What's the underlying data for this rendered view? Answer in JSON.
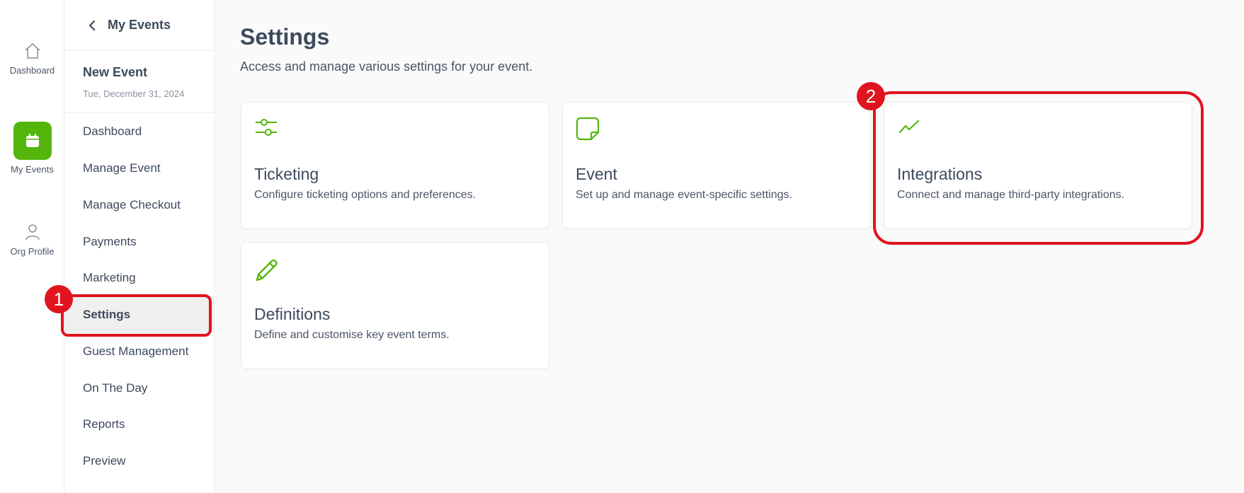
{
  "rail": {
    "items": [
      {
        "label": "Dashboard",
        "icon": "home-icon"
      },
      {
        "label": "My Events",
        "icon": "calendar-icon",
        "active": true
      },
      {
        "label": "Org Profile",
        "icon": "user-icon"
      }
    ]
  },
  "sidenav": {
    "back_label": "My Events",
    "event_name": "New Event",
    "event_date": "Tue, December 31, 2024",
    "items": [
      {
        "label": "Dashboard"
      },
      {
        "label": "Manage Event"
      },
      {
        "label": "Manage Checkout"
      },
      {
        "label": "Payments"
      },
      {
        "label": "Marketing"
      },
      {
        "label": "Settings",
        "active": true
      },
      {
        "label": "Guest Management"
      },
      {
        "label": "On The Day"
      },
      {
        "label": "Reports"
      },
      {
        "label": "Preview"
      }
    ]
  },
  "main": {
    "title": "Settings",
    "subtitle": "Access and manage various settings for your event.",
    "cards": [
      {
        "title": "Ticketing",
        "desc": "Configure ticketing options and preferences.",
        "icon": "sliders-icon"
      },
      {
        "title": "Event",
        "desc": "Set up and manage event-specific settings.",
        "icon": "sticky-note-icon"
      },
      {
        "title": "Integrations",
        "desc": "Connect and manage third-party integrations.",
        "icon": "trend-line-icon"
      },
      {
        "title": "Definitions",
        "desc": "Define and customise key event terms.",
        "icon": "pencil-icon"
      }
    ]
  },
  "annotations": {
    "badge_1": "1",
    "badge_2": "2"
  },
  "colors": {
    "accent": "#54b50c",
    "highlight": "#e0141e"
  }
}
